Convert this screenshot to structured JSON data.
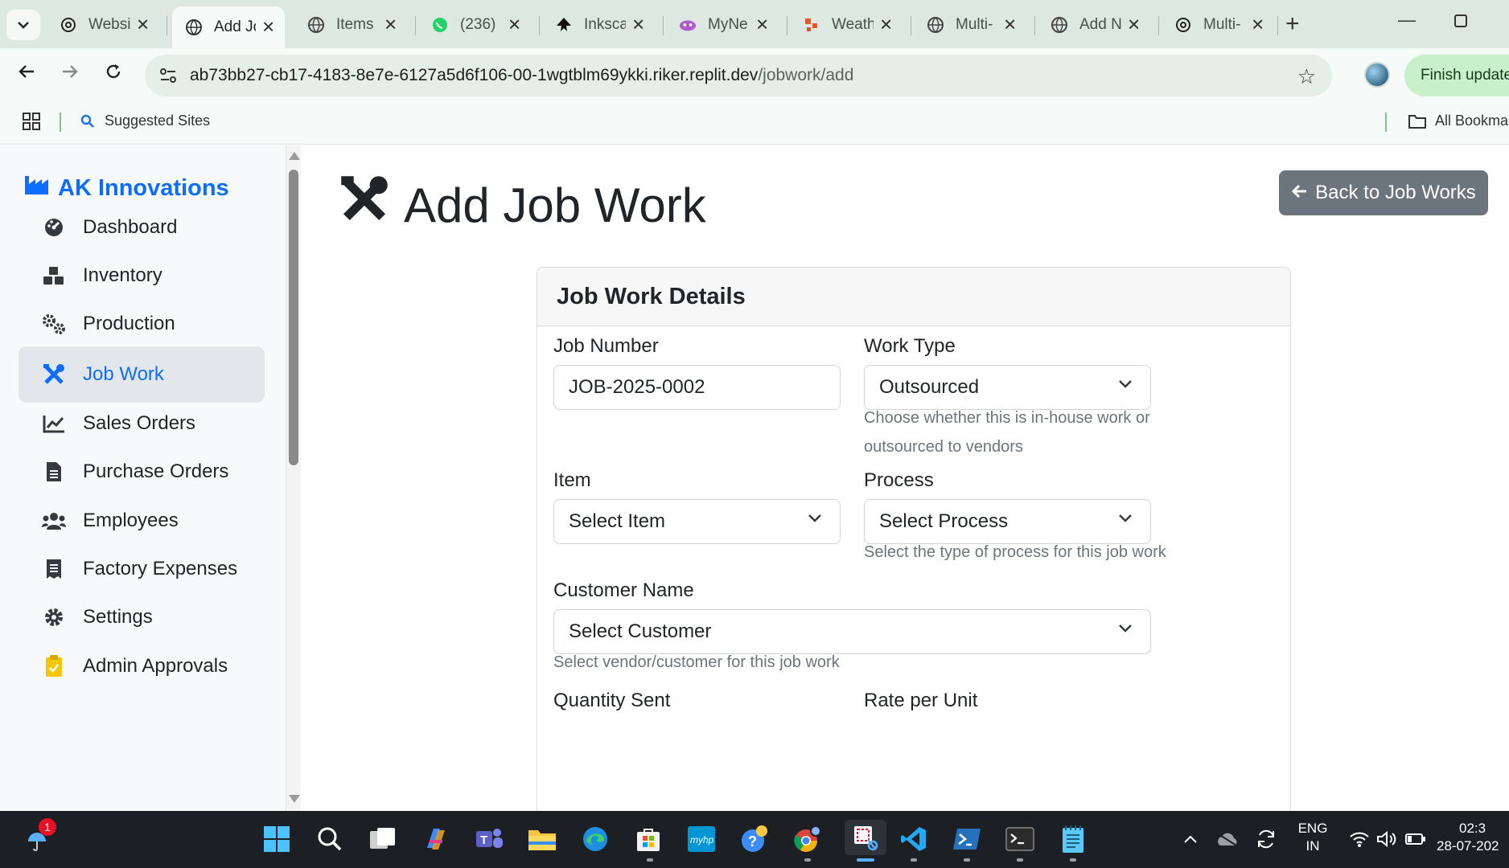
{
  "browser": {
    "tabs": [
      {
        "title": "Websi",
        "icon": "openai-icon",
        "active": false
      },
      {
        "title": "Add Jo",
        "icon": "globe-icon",
        "active": true
      },
      {
        "title": "Items",
        "icon": "globe-icon",
        "active": false
      },
      {
        "title": "(236)",
        "icon": "whatsapp-icon",
        "active": false
      },
      {
        "title": "Inksca",
        "icon": "inkscape-icon",
        "active": false
      },
      {
        "title": "MyNe",
        "icon": "myne-icon",
        "active": false
      },
      {
        "title": "Weath",
        "icon": "weather-icon",
        "active": false
      },
      {
        "title": "Multi-",
        "icon": "globe-icon",
        "active": false
      },
      {
        "title": "Add N",
        "icon": "globe-icon",
        "active": false
      },
      {
        "title": "Multi-",
        "icon": "openai-icon",
        "active": false
      }
    ],
    "url_host": "ab73bb27-cb17-4183-8e7e-6127a5d6f106-00-1wgtblm69ykki.riker.replit.dev",
    "url_path": "/jobwork/add",
    "finish_update": "Finish update",
    "bookmarks": {
      "suggested": "Suggested Sites",
      "all": "All Bookma"
    }
  },
  "sidebar": {
    "brand": "AK Innovations",
    "items": [
      {
        "label": "Dashboard",
        "icon": "dashboard-gauge-icon",
        "active": false
      },
      {
        "label": "Inventory",
        "icon": "boxes-icon",
        "active": false
      },
      {
        "label": "Production",
        "icon": "gears-icon",
        "active": false
      },
      {
        "label": "Job Work",
        "icon": "tools-icon",
        "active": true
      },
      {
        "label": "Sales Orders",
        "icon": "line-chart-icon",
        "active": false
      },
      {
        "label": "Purchase Orders",
        "icon": "document-icon",
        "active": false
      },
      {
        "label": "Employees",
        "icon": "users-icon",
        "active": false
      },
      {
        "label": "Factory Expenses",
        "icon": "receipt-icon",
        "active": false
      },
      {
        "label": "Settings",
        "icon": "gear-icon",
        "active": false
      },
      {
        "label": "Admin Approvals",
        "icon": "clipboard-check-icon",
        "active": false
      }
    ]
  },
  "page": {
    "title": "Add Job Work",
    "back_button": "Back to Job Works"
  },
  "form": {
    "card_title": "Job Work Details",
    "job_number_label": "Job Number",
    "job_number_value": "JOB-2025-0002",
    "work_type_label": "Work Type",
    "work_type_value": "Outsourced",
    "work_type_help": "Choose whether this is in-house work or outsourced to vendors",
    "item_label": "Item",
    "item_value": "Select Item",
    "process_label": "Process",
    "process_value": "Select Process",
    "process_help": "Select the type of process for this job work",
    "customer_label": "Customer Name",
    "customer_value": "Select Customer",
    "customer_help": "Select vendor/customer for this job work",
    "quantity_label": "Quantity Sent",
    "rate_label": "Rate per Unit"
  },
  "taskbar": {
    "notification_count": "1",
    "lang_top": "ENG",
    "lang_bottom": "IN",
    "time": "02:3",
    "date": "28-07-202"
  },
  "colors": {
    "primary": "#0d6efd",
    "secondary_button": "#6c757d",
    "sidebar_bg": "#f8f9fa",
    "taskbar_bg": "#1c2025"
  }
}
